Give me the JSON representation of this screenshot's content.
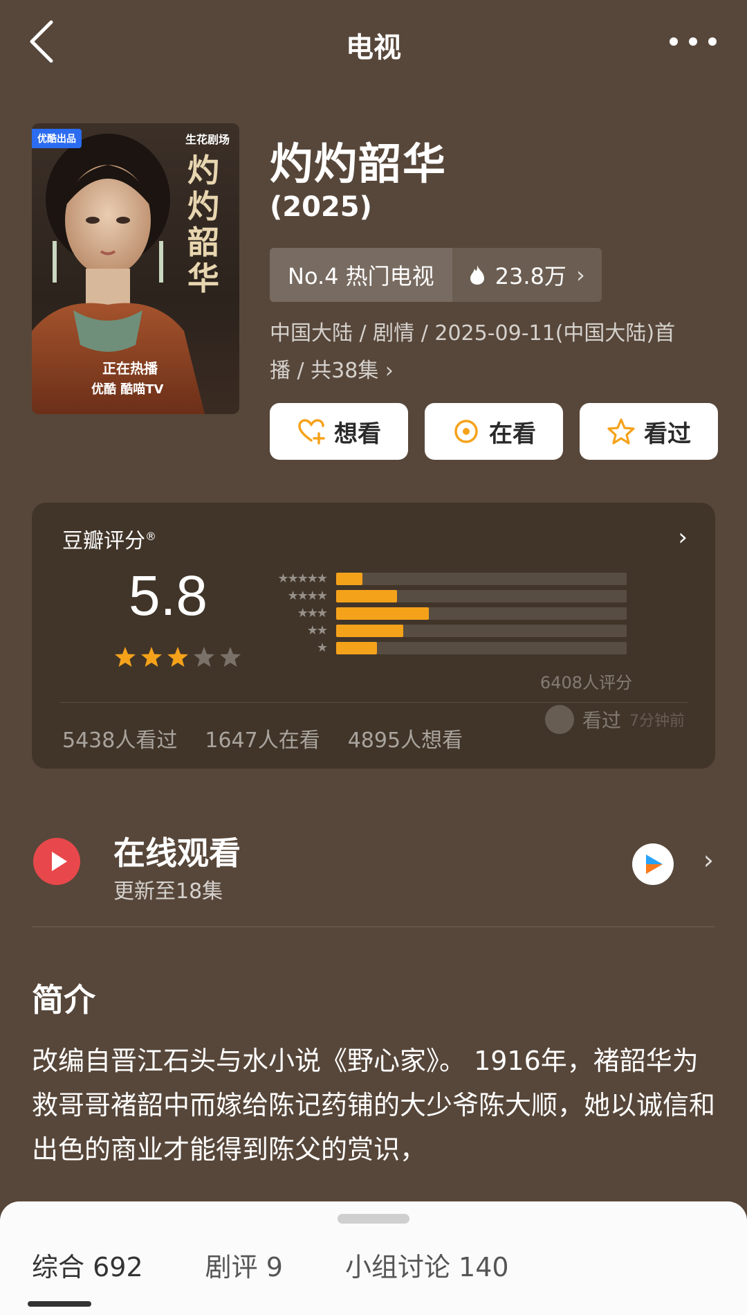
{
  "header": {
    "title": "电视"
  },
  "poster": {
    "badge": "优酷出品",
    "studio": "生花剧场",
    "vertical_title": "灼灼韶华",
    "airing": "正在热播",
    "platforms": "优酷  酷喵TV"
  },
  "show": {
    "title": "灼灼韶华",
    "year": "(2025)",
    "rank": "No.4 热门电视",
    "heat": "23.8万",
    "meta_line1": "中国大陆 / 剧情 / 2025-09-11(中国大陆)首",
    "meta_line2": "播 / 共38集"
  },
  "actions": [
    {
      "label": "想看",
      "icon": "heart-plus-icon"
    },
    {
      "label": "在看",
      "icon": "target-circle-icon"
    },
    {
      "label": "看过",
      "icon": "star-outline-icon"
    }
  ],
  "rating": {
    "label": "豆瓣评分",
    "registered": "®",
    "score": "5.8",
    "stars": 3,
    "max_stars": 5,
    "distribution": [
      {
        "stars": "★★★★★",
        "fraction": 0.09
      },
      {
        "stars": "★★★★",
        "fraction": 0.21
      },
      {
        "stars": "★★★",
        "fraction": 0.32
      },
      {
        "stars": "★★",
        "fraction": 0.23
      },
      {
        "stars": "★",
        "fraction": 0.14
      }
    ],
    "count": "6408人评分",
    "watched": "5438人看过",
    "watching": "1647人在看",
    "want": "4895人想看",
    "friend_status": "看过",
    "friend_time": "7分钟前",
    "star_color": "#f5a21b"
  },
  "watch": {
    "title": "在线观看",
    "subtitle": "更新至18集"
  },
  "synopsis": {
    "title": "简介",
    "text": "改编自晋江石头与水小说《野心家》。 1916年，褚韶华为救哥哥褚韶中而嫁给陈记药铺的大少爷陈大顺，她以诚信和出色的商业才能得到陈父的赏识，"
  },
  "tabs": [
    {
      "label": "综合",
      "count": "692"
    },
    {
      "label": "剧评",
      "count": "9"
    },
    {
      "label": "小组讨论",
      "count": "140"
    }
  ]
}
